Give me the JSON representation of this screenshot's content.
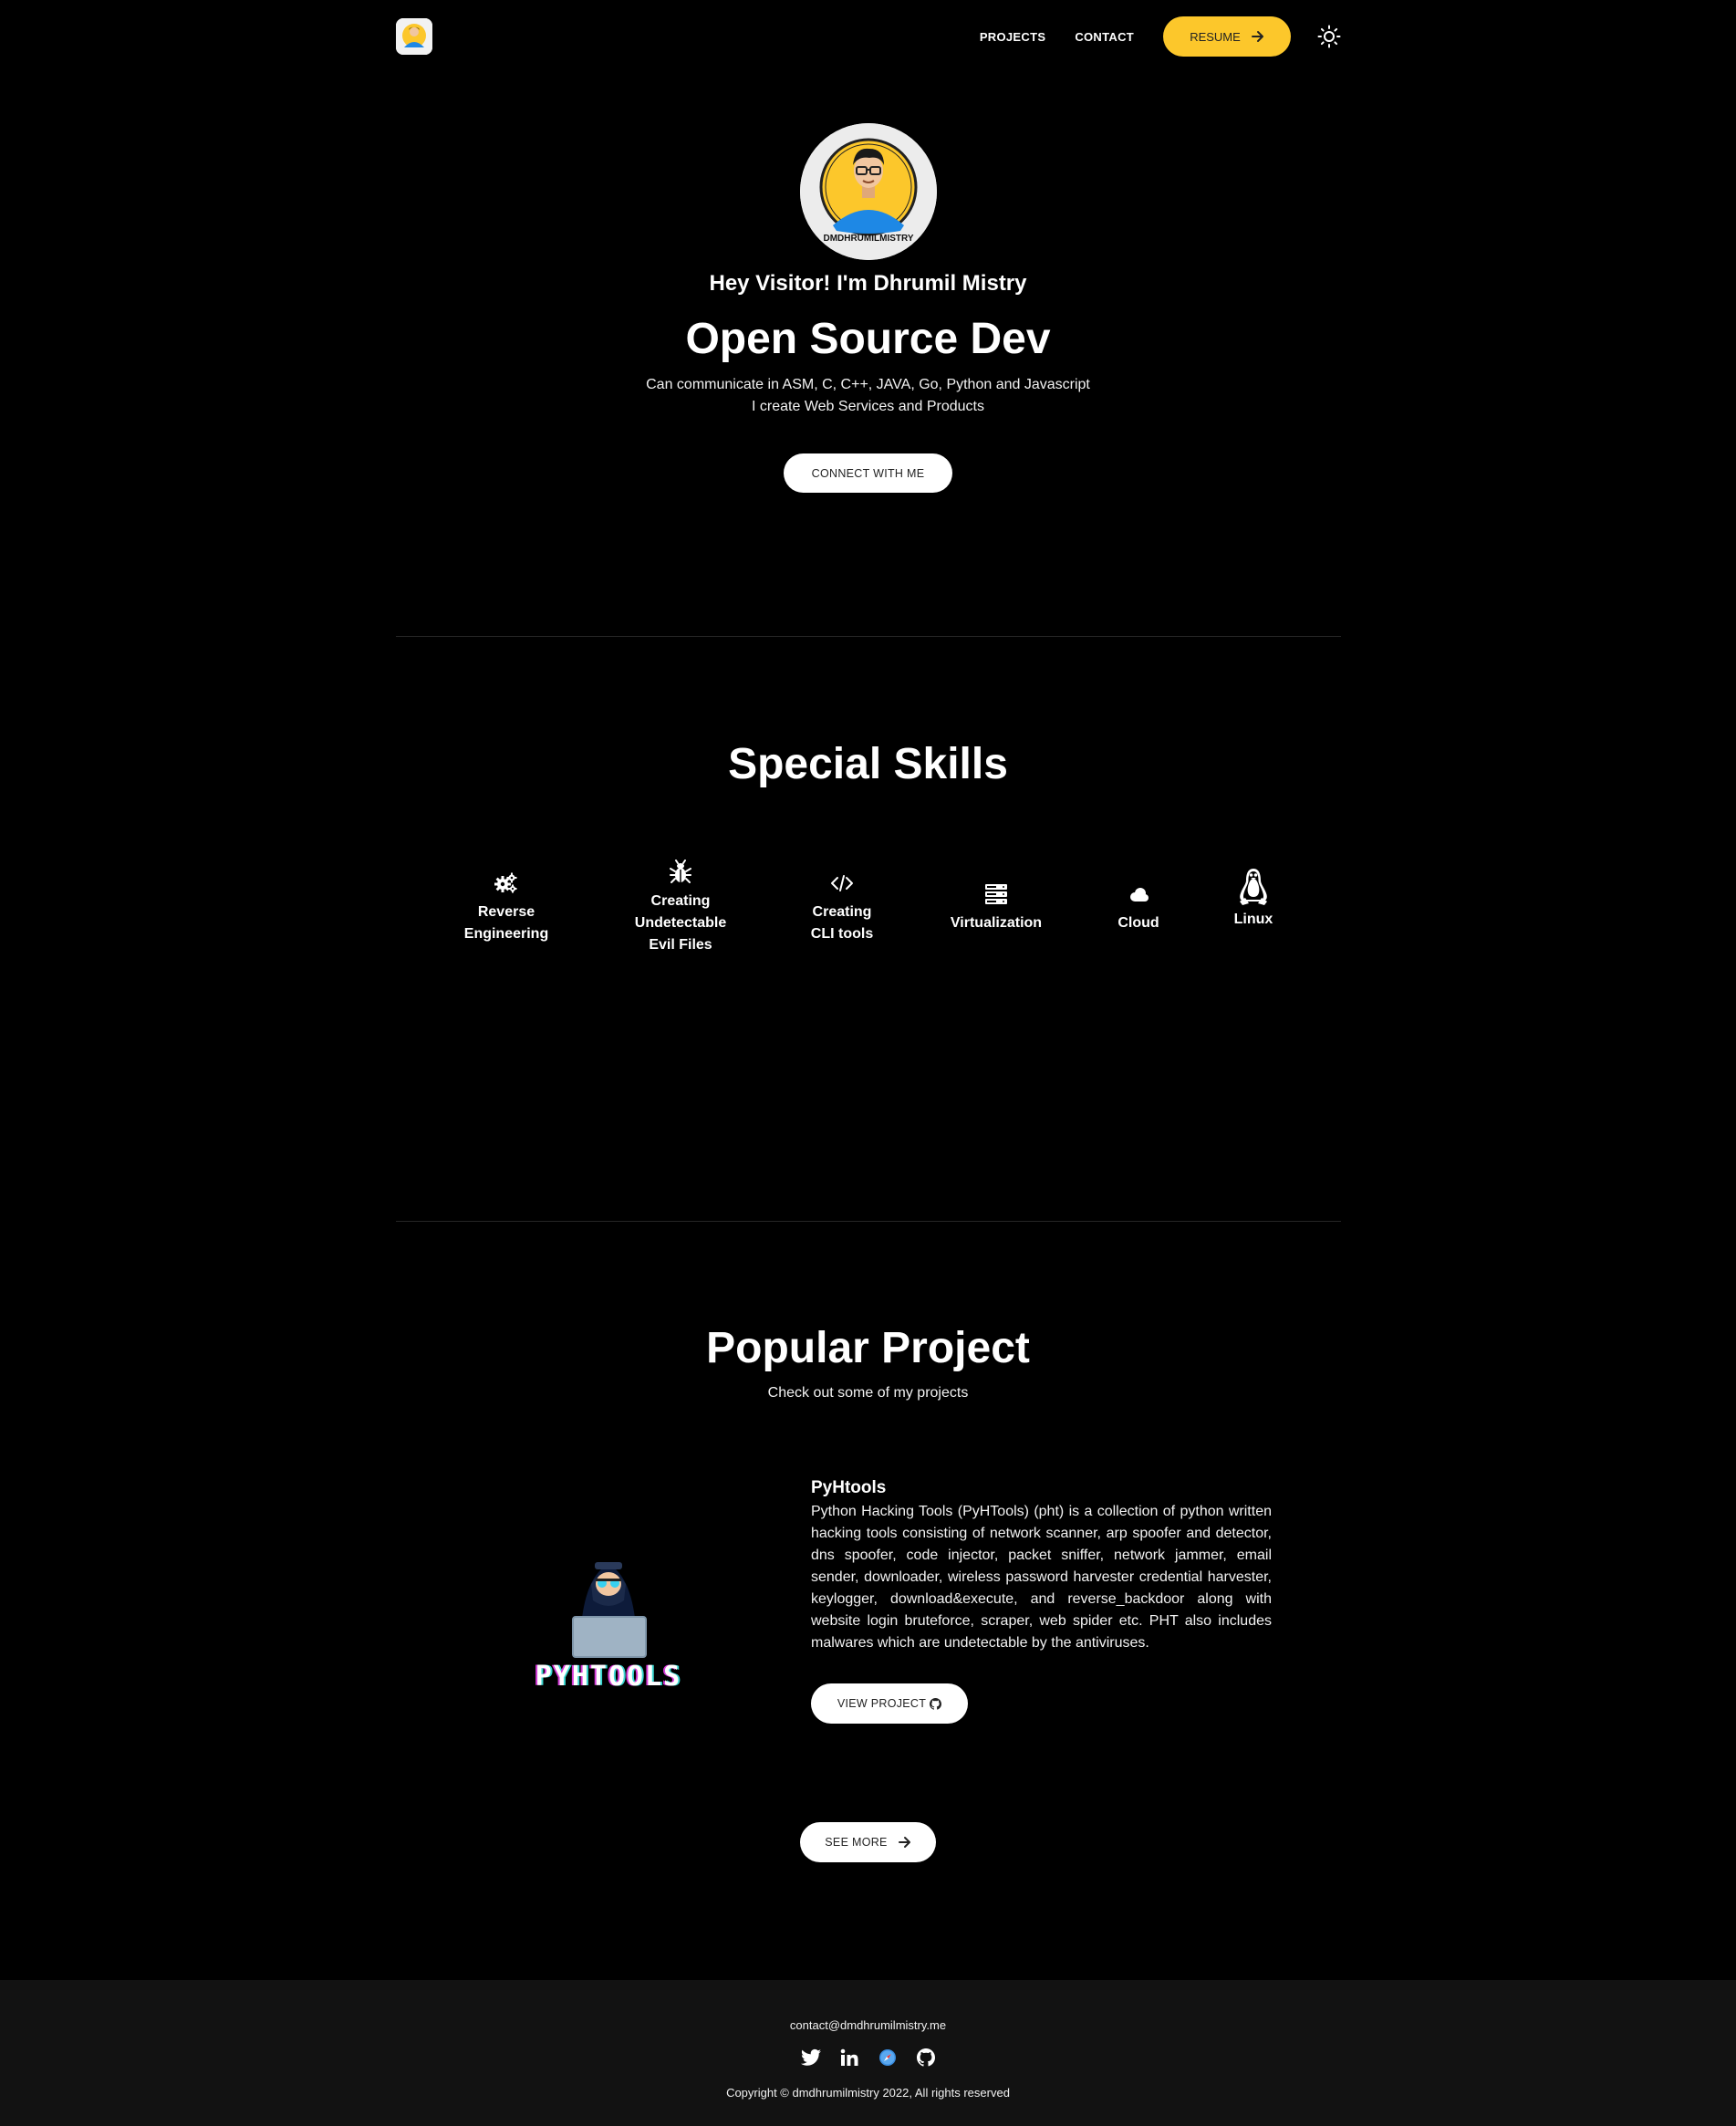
{
  "nav": {
    "links": [
      "PROJECTS",
      "CONTACT"
    ],
    "resume_label": "RESUME",
    "logo_icon": "avatar-logo-icon",
    "theme_icon": "sun-icon"
  },
  "hero": {
    "avatar_caption": "DMDHRUMILMISTRY",
    "greeting": "Hey Visitor! I'm Dhrumil Mistry",
    "title": "Open Source Dev",
    "line1": "Can communicate in ASM, C, C++, JAVA, Go, Python and Javascript",
    "line2": "I create Web Services and Products",
    "connect_label": "CONNECT WITH ME"
  },
  "skills": {
    "title": "Special Skills",
    "items": [
      {
        "label": "Reverse\nEngineering",
        "icon": "gears-icon"
      },
      {
        "label": "Creating\nUndetectable\nEvil Files",
        "icon": "bug-icon"
      },
      {
        "label": "Creating\nCLI tools",
        "icon": "code-icon"
      },
      {
        "label": "Virtualization",
        "icon": "server-icon"
      },
      {
        "label": "Cloud",
        "icon": "cloud-icon"
      },
      {
        "label": "Linux",
        "icon": "tux-icon"
      }
    ]
  },
  "projects": {
    "title": "Popular Project",
    "subtitle": "Check out some of my projects",
    "featured": {
      "logo_text": "PYHTOOLS",
      "name": "PyHtools",
      "description": "Python Hacking Tools (PyHTools) (pht) is a collection of python written hacking tools consisting of network scanner, arp spoofer and detector, dns spoofer, code injector, packet sniffer, network jammer, email sender, downloader, wireless password harvester credential harvester, keylogger, download&execute, and reverse_backdoor along with website login bruteforce, scraper, web spider etc. PHT also includes malwares which are undetectable by the antiviruses.",
      "view_label": "VIEW PROJECT"
    },
    "see_more_label": "SEE MORE"
  },
  "footer": {
    "email": "contact@dmdhrumilmistry.me",
    "social": [
      "twitter-icon",
      "linkedin-icon",
      "safari-icon",
      "github-icon"
    ],
    "copyright": "Copyright © dmdhrumilmistry 2022, All rights reserved"
  },
  "colors": {
    "background": "#000000",
    "accent": "#fcc72b",
    "footer_bg": "#121212"
  }
}
